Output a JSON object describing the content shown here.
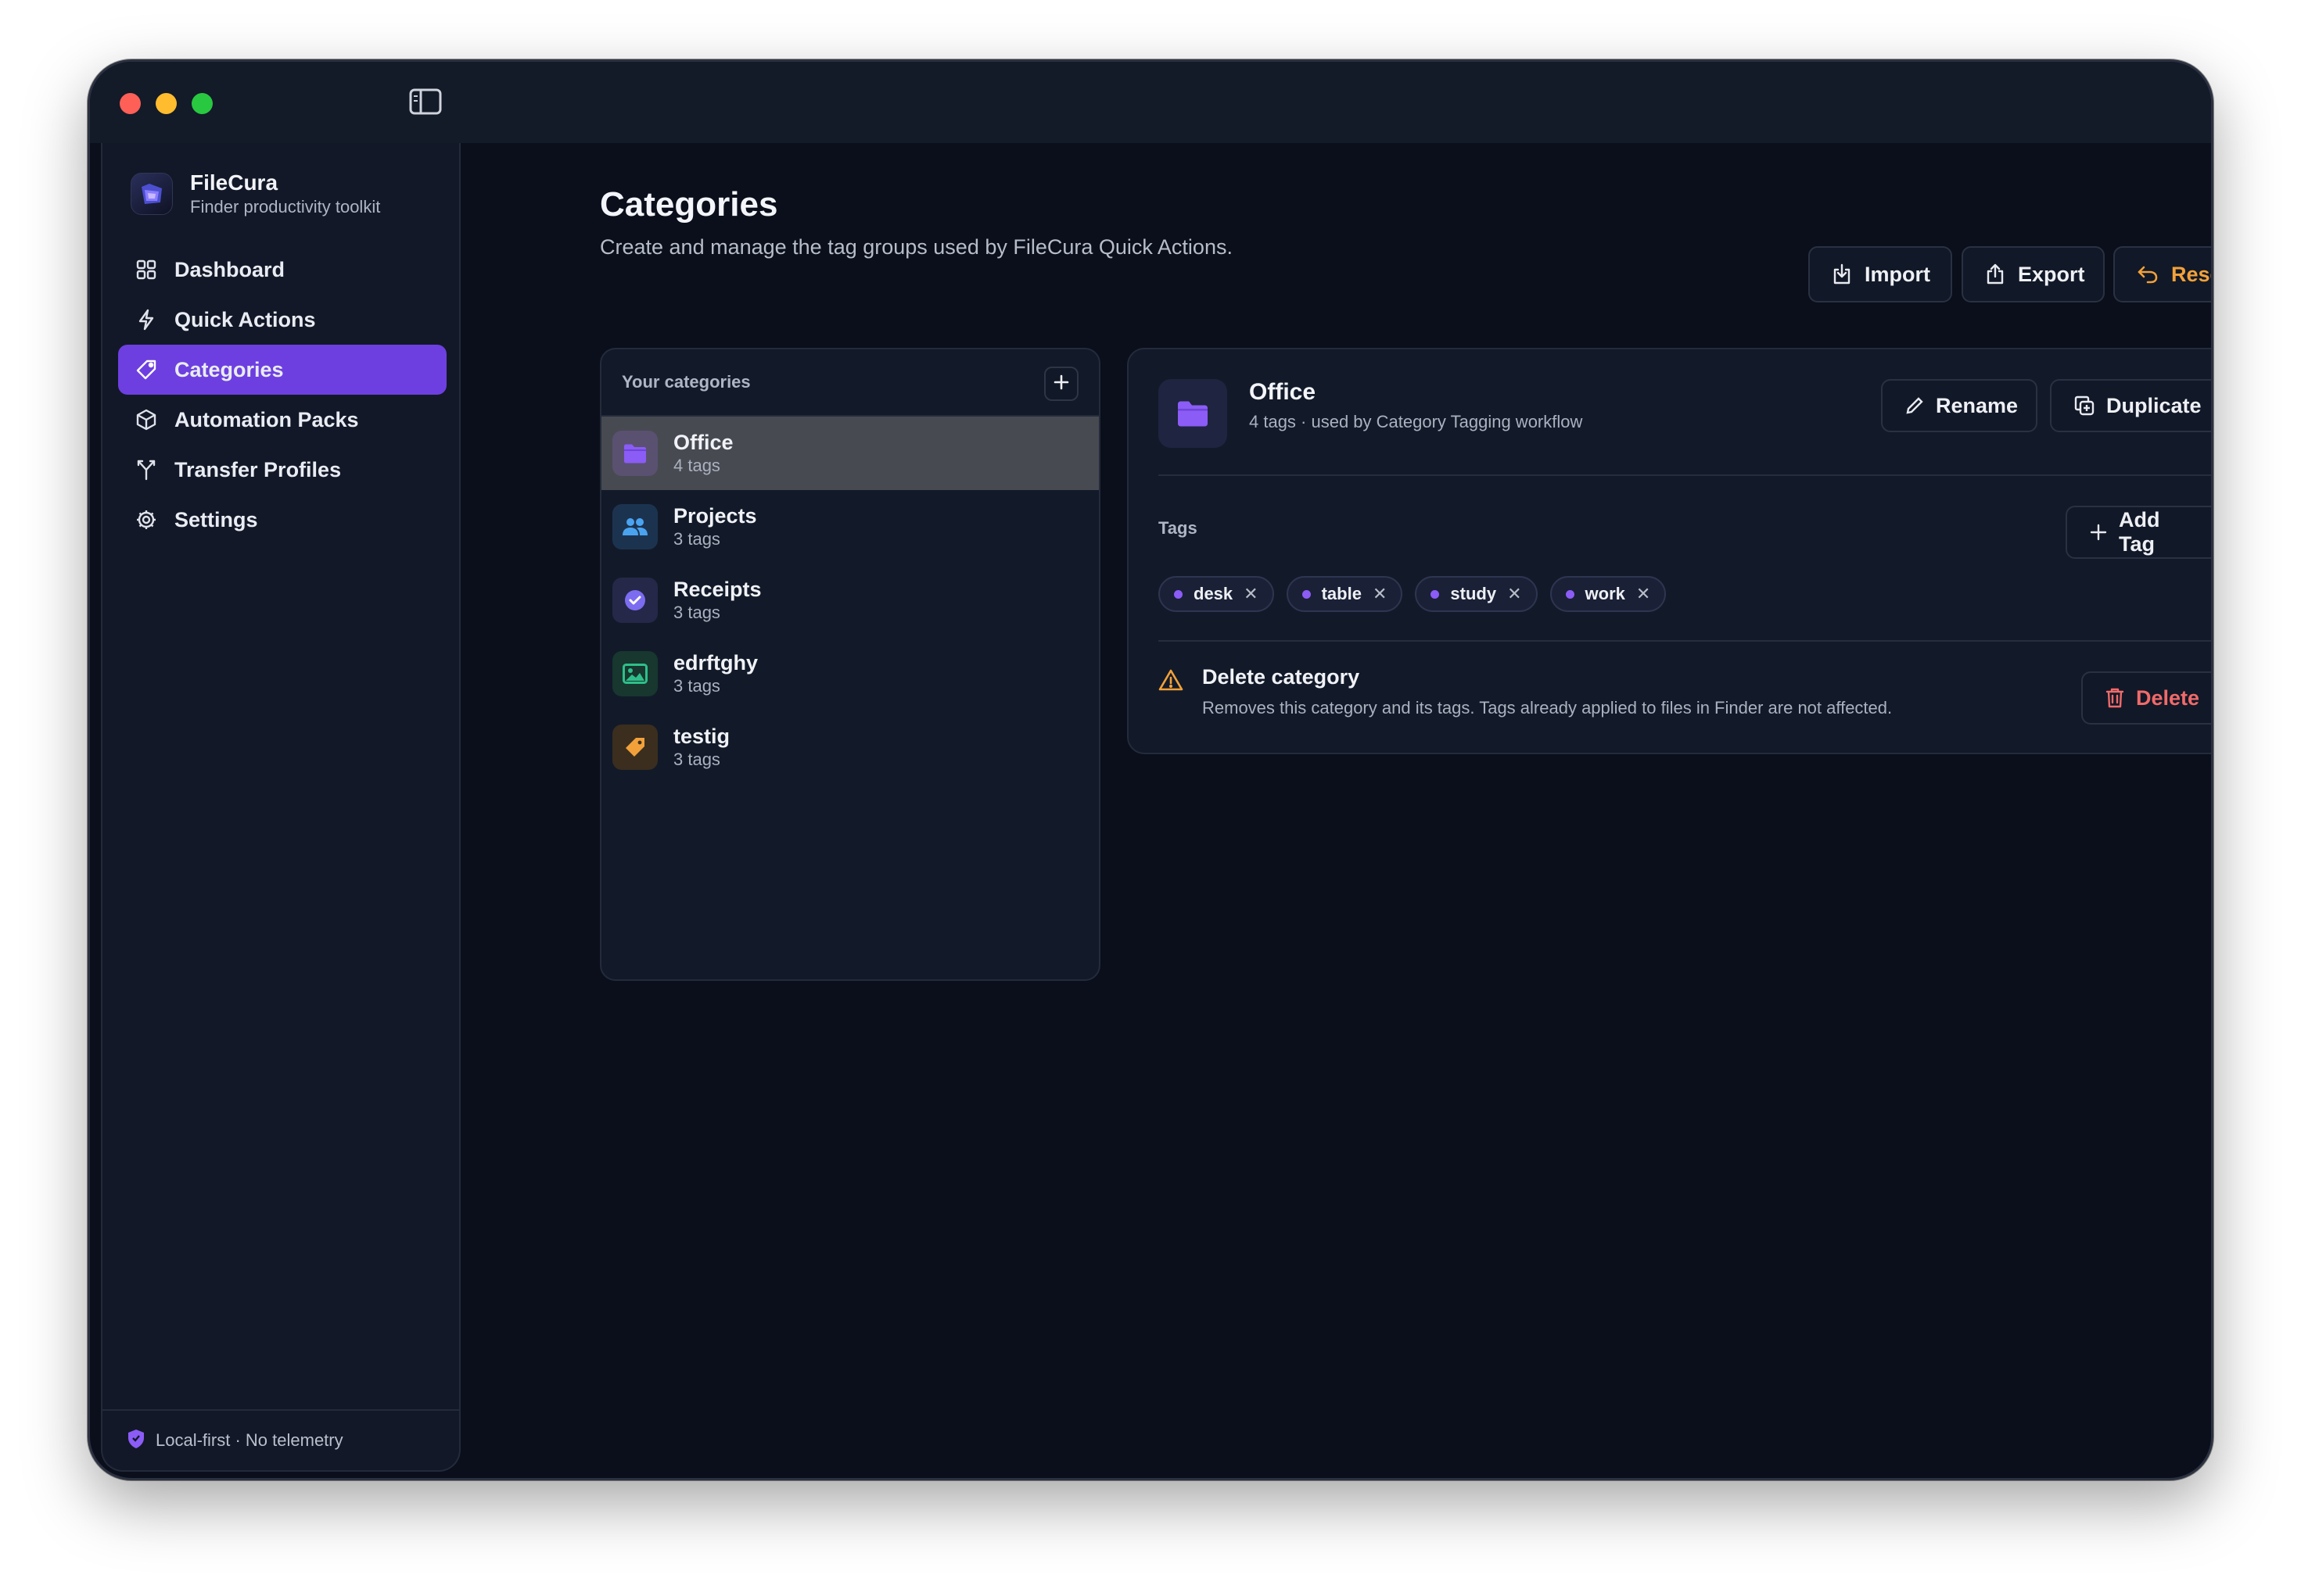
{
  "app": {
    "name": "FileCura",
    "subtitle": "Finder productivity toolkit"
  },
  "sidebar": {
    "items": [
      {
        "label": "Dashboard",
        "icon": "grid-icon"
      },
      {
        "label": "Quick Actions",
        "icon": "bolt-icon"
      },
      {
        "label": "Categories",
        "icon": "tag-icon",
        "active": true
      },
      {
        "label": "Automation Packs",
        "icon": "cube-icon"
      },
      {
        "label": "Transfer Profiles",
        "icon": "fork-icon"
      },
      {
        "label": "Settings",
        "icon": "gear-icon"
      }
    ],
    "footer": "Local-first · No telemetry"
  },
  "header": {
    "title": "Categories",
    "subtitle": "Create and manage the tag groups used by FileCura Quick Actions.",
    "import_label": "Import",
    "export_label": "Export",
    "reset_label": "Reset"
  },
  "categories": {
    "title": "Your categories",
    "list": [
      {
        "name": "Office",
        "count": "4 tags",
        "icon": "folder-icon",
        "color": "#8b5cf6",
        "selected": true
      },
      {
        "name": "Projects",
        "count": "3 tags",
        "icon": "people-icon",
        "color": "#4aa3f0"
      },
      {
        "name": "Receipts",
        "count": "3 tags",
        "icon": "check-badge-icon",
        "color": "#7c6cf0"
      },
      {
        "name": "edrftghy",
        "count": "3 tags",
        "icon": "image-icon",
        "color": "#2fbf8a"
      },
      {
        "name": "testig",
        "count": "3 tags",
        "icon": "tag-icon",
        "color": "#f2a13a"
      }
    ]
  },
  "detail": {
    "name": "Office",
    "meta": "4 tags · used by Category Tagging workflow",
    "rename_label": "Rename",
    "duplicate_label": "Duplicate",
    "tags_label": "Tags",
    "add_tag_label": "Add Tag",
    "tags": [
      "desk",
      "table",
      "study",
      "work"
    ],
    "delete": {
      "title": "Delete category",
      "text": "Removes this category and its tags. Tags already applied to files in Finder are not affected.",
      "button": "Delete"
    }
  },
  "colors": {
    "accent": "#6d3fe0",
    "warning": "#f2a13a",
    "danger": "#f06a6a",
    "background": "#0a0f1b"
  }
}
